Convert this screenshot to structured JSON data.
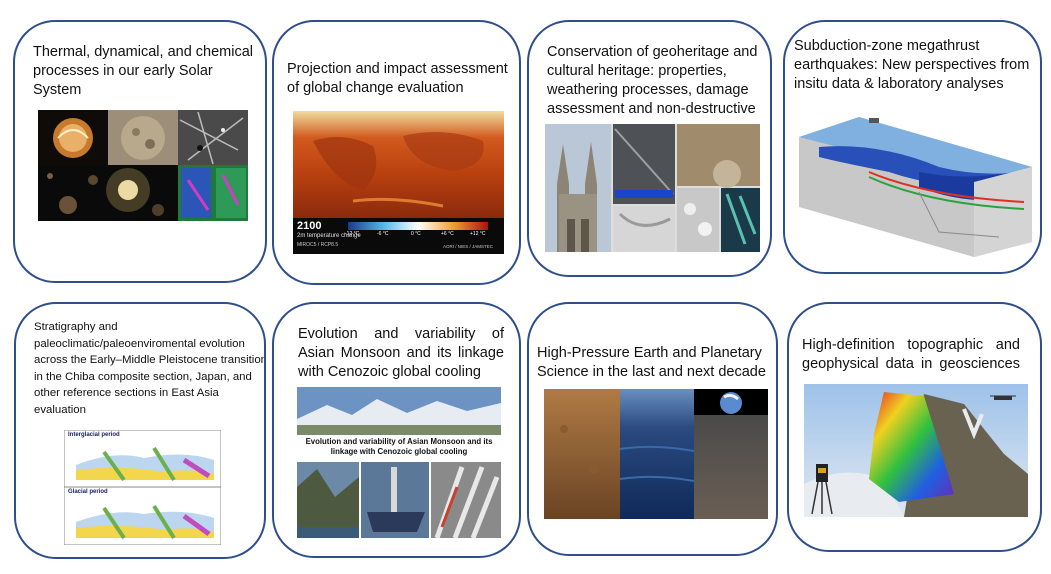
{
  "cards": [
    {
      "title": "Thermal, dynamical, and chemical processes in our early Solar System"
    },
    {
      "title": "Projection and impact assessment of global change evaluation",
      "figure": {
        "year": "2100",
        "sub": "2m temperature change",
        "model": "MIROC5 / RCP8.5",
        "credit": "AORI / NIES / JAMSTEC",
        "ticks": [
          "-12 °C",
          "-6 °C",
          "0 °C",
          "+6 °C",
          "+12 °C"
        ]
      }
    },
    {
      "title": "Conservation of geoheritage and cultural heritage: properties, weathering processes, damage assessment and non-destructive"
    },
    {
      "title": "Subduction-zone megathrust earthquakes: New perspectives from insitu data & laboratory analyses"
    },
    {
      "title": "Stratigraphy and paleoclimatic/paleoenviromental evolution across the Early–Middle Pleistocene transition in the Chiba composite section, Japan, and other reference sections in East Asia evaluation",
      "figure": {
        "top": "Interglacial period",
        "bottom": "Glacial period"
      }
    },
    {
      "title": "Evolution and variability of Asian Monsoon and its linkage with Cenozoic global cooling",
      "figure": {
        "caption": "Evolution and variability of Asian Monsoon and its linkage with Cenozoic global cooling"
      }
    },
    {
      "title": "High-Pressure Earth and Planetary Science in the last and next decade"
    },
    {
      "title": "High-definition topographic and geophysical data in geosciences"
    }
  ],
  "colors": {
    "border": "#2f4e8c"
  }
}
